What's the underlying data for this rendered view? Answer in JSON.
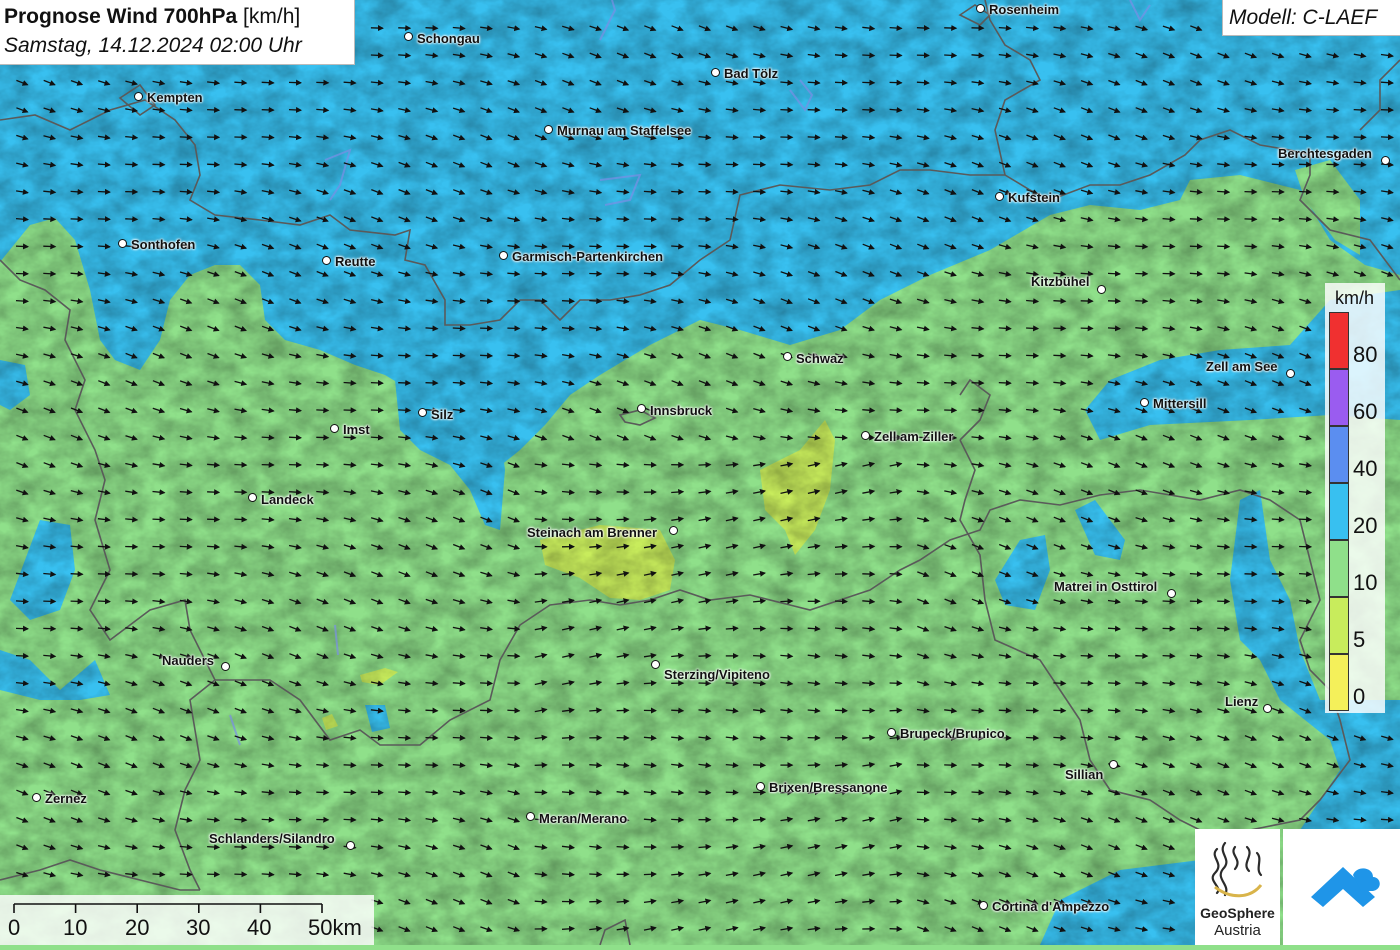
{
  "header": {
    "title": "Prognose Wind 700hPa",
    "title_unit": "[km/h]",
    "subtitle": "Samstag, 14.12.2024 02:00 Uhr",
    "model": "Modell: C-LAEF"
  },
  "cities": [
    {
      "name": "Rosenheim",
      "id": "rosenheim"
    },
    {
      "name": "Schongau",
      "id": "schongau"
    },
    {
      "name": "Bad Tölz",
      "id": "bad-toelz"
    },
    {
      "name": "Kempten",
      "id": "kempten"
    },
    {
      "name": "Murnau am Staffelsee",
      "id": "murnau"
    },
    {
      "name": "Berchtesgaden",
      "id": "berchtesgaden"
    },
    {
      "name": "Kufstein",
      "id": "kufstein"
    },
    {
      "name": "Sonthofen",
      "id": "sonthofen"
    },
    {
      "name": "Reutte",
      "id": "reutte"
    },
    {
      "name": "Garmisch-Partenkirchen",
      "id": "garmisch"
    },
    {
      "name": "Kitzbühel",
      "id": "kitzbuehel"
    },
    {
      "name": "Schwaz",
      "id": "schwaz"
    },
    {
      "name": "Zell am See",
      "id": "zell-am-see"
    },
    {
      "name": "Mittersill",
      "id": "mittersill"
    },
    {
      "name": "Silz",
      "id": "silz"
    },
    {
      "name": "Innsbruck",
      "id": "innsbruck"
    },
    {
      "name": "Imst",
      "id": "imst"
    },
    {
      "name": "Zell am Ziller",
      "id": "zell-am-ziller"
    },
    {
      "name": "Landeck",
      "id": "landeck"
    },
    {
      "name": "Steinach am Brenner",
      "id": "steinach"
    },
    {
      "name": "Matrei in Osttirol",
      "id": "matrei"
    },
    {
      "name": "Nauders",
      "id": "nauders"
    },
    {
      "name": "Sterzing/Vipiteno",
      "id": "sterzing"
    },
    {
      "name": "Lienz",
      "id": "lienz"
    },
    {
      "name": "Bruneck/Brunico",
      "id": "bruneck"
    },
    {
      "name": "Sillian",
      "id": "sillian"
    },
    {
      "name": "Brixen/Bressanone",
      "id": "brixen"
    },
    {
      "name": "Zernez",
      "id": "zernez"
    },
    {
      "name": "Meran/Merano",
      "id": "meran"
    },
    {
      "name": "Schlanders/Silandro",
      "id": "schlanders"
    },
    {
      "name": "Cortina d'Ampezzo",
      "id": "cortina"
    }
  ],
  "legend": {
    "unit": "km/h",
    "bins": [
      {
        "label": "80",
        "color": "#f03030"
      },
      {
        "label": "60",
        "color": "#9a5cf0"
      },
      {
        "label": "40",
        "color": "#5b8ef0"
      },
      {
        "label": "20",
        "color": "#38c0f0"
      },
      {
        "label": "10",
        "color": "#8fe08a"
      },
      {
        "label": "5",
        "color": "#c8ec5c"
      },
      {
        "label": "0",
        "color": "#f4f05a"
      }
    ],
    "top_color": "#f03030"
  },
  "scale_bar": {
    "labels": [
      "0",
      "10",
      "20",
      "30",
      "40",
      "50km"
    ]
  },
  "logos": {
    "geosphere_name": "GeoSphere",
    "geosphere_sub": "Austria"
  },
  "colors": {
    "wind_0_5": "#f4f05a",
    "wind_5_10": "#c8ec5c",
    "wind_10_20": "#8fe08a",
    "wind_20_40": "#38c0f0",
    "border": "#555555"
  }
}
